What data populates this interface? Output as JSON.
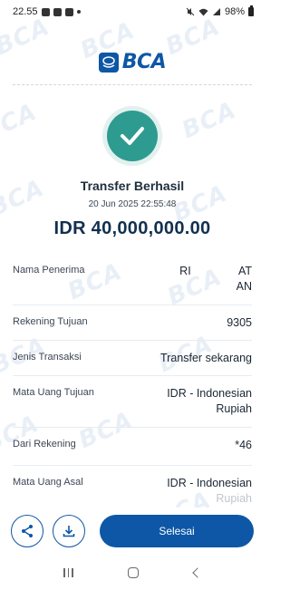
{
  "status_bar": {
    "time": "22.55",
    "battery": "98%"
  },
  "logo": {
    "text": "BCA"
  },
  "result": {
    "title": "Transfer Berhasil",
    "datetime": "20 Jun 2025 22:55:48",
    "amount": "IDR 40,000,000.00"
  },
  "details": {
    "recipient_label": "Nama Penerima",
    "recipient_line1_a": "RI",
    "recipient_line1_b": "AT",
    "recipient_line2": "AN",
    "account_label": "Rekening Tujuan",
    "account_value": "9305",
    "type_label": "Jenis Transaksi",
    "type_value": "Transfer sekarang",
    "dest_currency_label": "Mata Uang Tujuan",
    "dest_currency_value_1": "IDR - Indonesian",
    "dest_currency_value_2": "Rupiah",
    "from_account_label": "Dari Rekening",
    "from_account_value": "*46",
    "src_currency_label": "Mata Uang Asal",
    "src_currency_value_1": "IDR - Indonesian",
    "src_currency_value_2": "Rupiah"
  },
  "actions": {
    "done_label": "Selesai"
  },
  "watermark_text": "BCA",
  "colors": {
    "brand": "#0d57a6",
    "success": "#2e9b91"
  }
}
